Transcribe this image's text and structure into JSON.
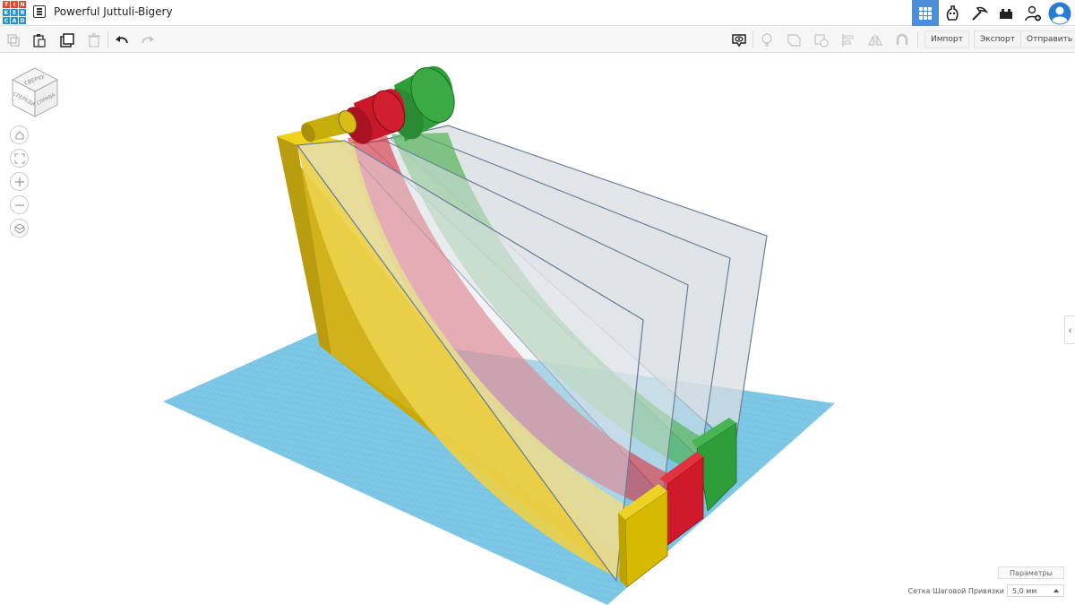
{
  "app": {
    "logo_letters": [
      "T",
      "I",
      "N",
      "K",
      "E",
      "R",
      "C",
      "A",
      "D"
    ],
    "logo_colors": [
      "#e8472c",
      "#e8472c",
      "#e8472c",
      "#1f92d8",
      "#1f92d8",
      "#1f92d8",
      "#1f92d8",
      "#1f92d8",
      "#1f92d8"
    ],
    "design_title": "Powerful Juttuli-Bigery"
  },
  "topbar": {
    "icons": [
      "grid-view-icon",
      "blocks-mode-icon",
      "bricks-mode-icon",
      "lego-mode-icon",
      "add-user-icon",
      "user-avatar-icon"
    ],
    "active_color": "#4c8fd6"
  },
  "toolbar": {
    "left_icons": [
      "copy-icon",
      "paste-icon",
      "duplicate-icon",
      "delete-icon",
      "undo-icon",
      "redo-icon"
    ],
    "right_icons": [
      "show-hide-icon",
      "light-bulb-icon",
      "group-icon",
      "ungroup-icon",
      "align-icon",
      "mirror-icon",
      "magnet-icon"
    ],
    "import_label": "Импорт",
    "export_label": "Экспорт",
    "send_label": "Отправить"
  },
  "viewcube": {
    "top_label": "СВЕРХУ",
    "front_label": "СПЕРЕДИ",
    "right_label": "СПРАВА"
  },
  "bottom_panel": {
    "params_label": "Параметры",
    "snap_grid_label": "Сетка Шаговой Привязки",
    "snap_grid_value": "5,0 мм"
  },
  "scene": {
    "workplane_color": "#7ec8e6",
    "shape_colors": {
      "yellow": "#e6c600",
      "red": "#d0162a",
      "green": "#2e9e3a",
      "glass": "#cfd6dc"
    }
  }
}
